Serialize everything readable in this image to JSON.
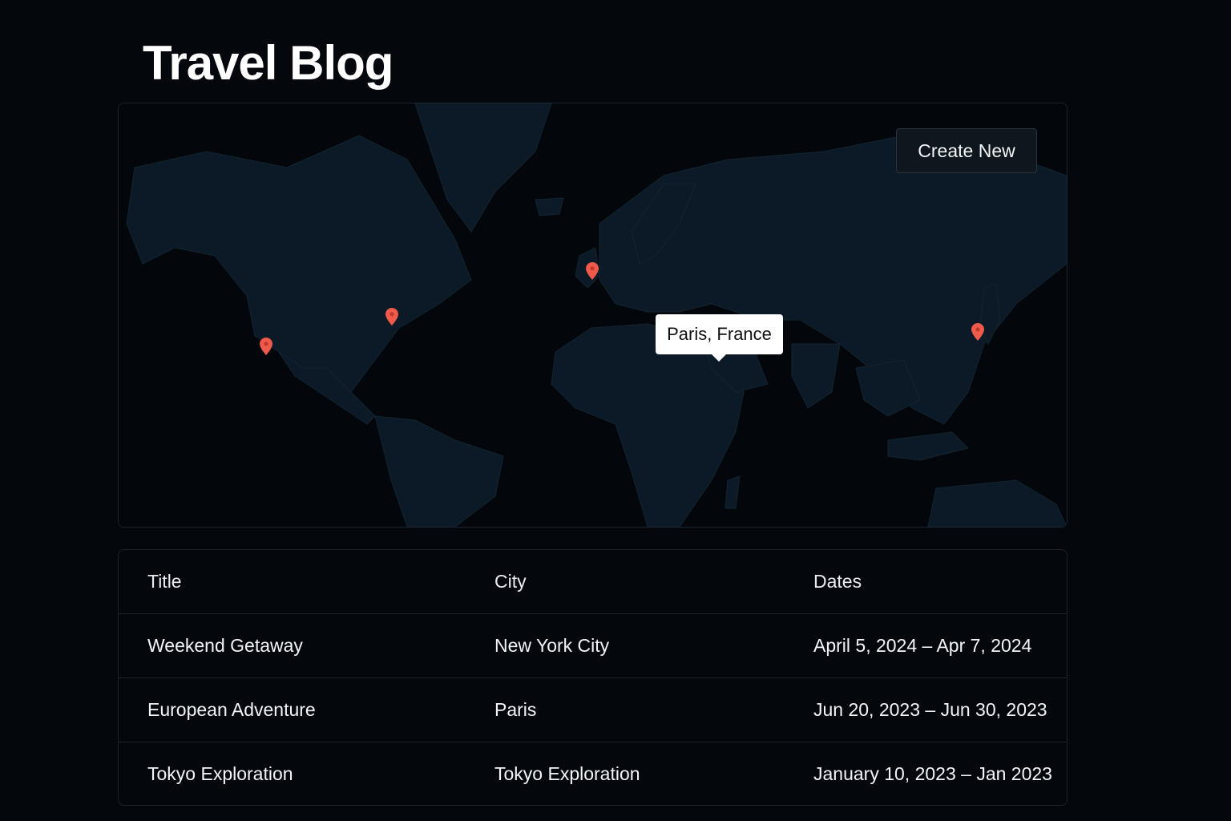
{
  "page": {
    "title": "Travel Blog"
  },
  "map": {
    "create_button_label": "Create New",
    "tooltip_label": "Paris, France",
    "pin_color": "#f05a4a",
    "land_color": "#0b1a26",
    "ocean_color": "#03070c",
    "pins": [
      {
        "name": "pin-los-angeles"
      },
      {
        "name": "pin-new-york"
      },
      {
        "name": "pin-paris"
      },
      {
        "name": "pin-tokyo"
      }
    ]
  },
  "table": {
    "columns": [
      "Title",
      "City",
      "Dates"
    ],
    "rows": [
      {
        "title": "Weekend Getaway",
        "city": "New York City",
        "dates": "April 5, 2024 – Apr 7, 2024"
      },
      {
        "title": "European Adventure",
        "city": "Paris",
        "dates": "Jun 20, 2023 – Jun 30, 2023"
      },
      {
        "title": "Tokyo Exploration",
        "city": "Tokyo Exploration",
        "dates": "January 10, 2023 – Jan 2023"
      }
    ]
  }
}
